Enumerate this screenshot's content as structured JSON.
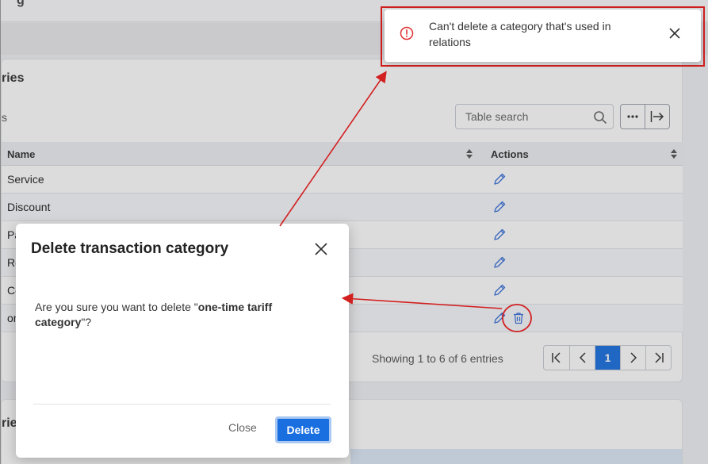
{
  "page": {
    "title_fragment": "g",
    "card_title_fragment": "ries",
    "card_left_fragment": "s",
    "card2_title_fragment": "ries"
  },
  "table": {
    "search_placeholder": "Table search",
    "headers": {
      "name": "Name",
      "actions": "Actions"
    },
    "rows": [
      {
        "name": "Service"
      },
      {
        "name": "Discount"
      },
      {
        "name": "Pa"
      },
      {
        "name": "Re"
      },
      {
        "name": "Co"
      },
      {
        "name": "on"
      }
    ],
    "entries_info": "Showing 1 to 6 of 6 entries",
    "pagination": {
      "current_page": "1"
    }
  },
  "toast": {
    "message": "Can't delete a category that's used in relations",
    "type": "error"
  },
  "modal": {
    "title": "Delete transaction category",
    "body_prefix": "Are you sure you want to delete \"",
    "body_name": "one-time tariff category",
    "body_suffix": "\"?",
    "close_label": "Close",
    "delete_label": "Delete"
  },
  "icons": {
    "search": "search-icon",
    "more": "more-icon",
    "export": "export-icon",
    "sort": "sort-icon",
    "edit": "pencil-icon",
    "delete": "trash-icon",
    "error": "exclamation-circle-icon",
    "close": "close-icon"
  },
  "colors": {
    "primary": "#1a6fe0",
    "annotation": "#d21f1f",
    "icon_blue": "#3a72d8"
  }
}
